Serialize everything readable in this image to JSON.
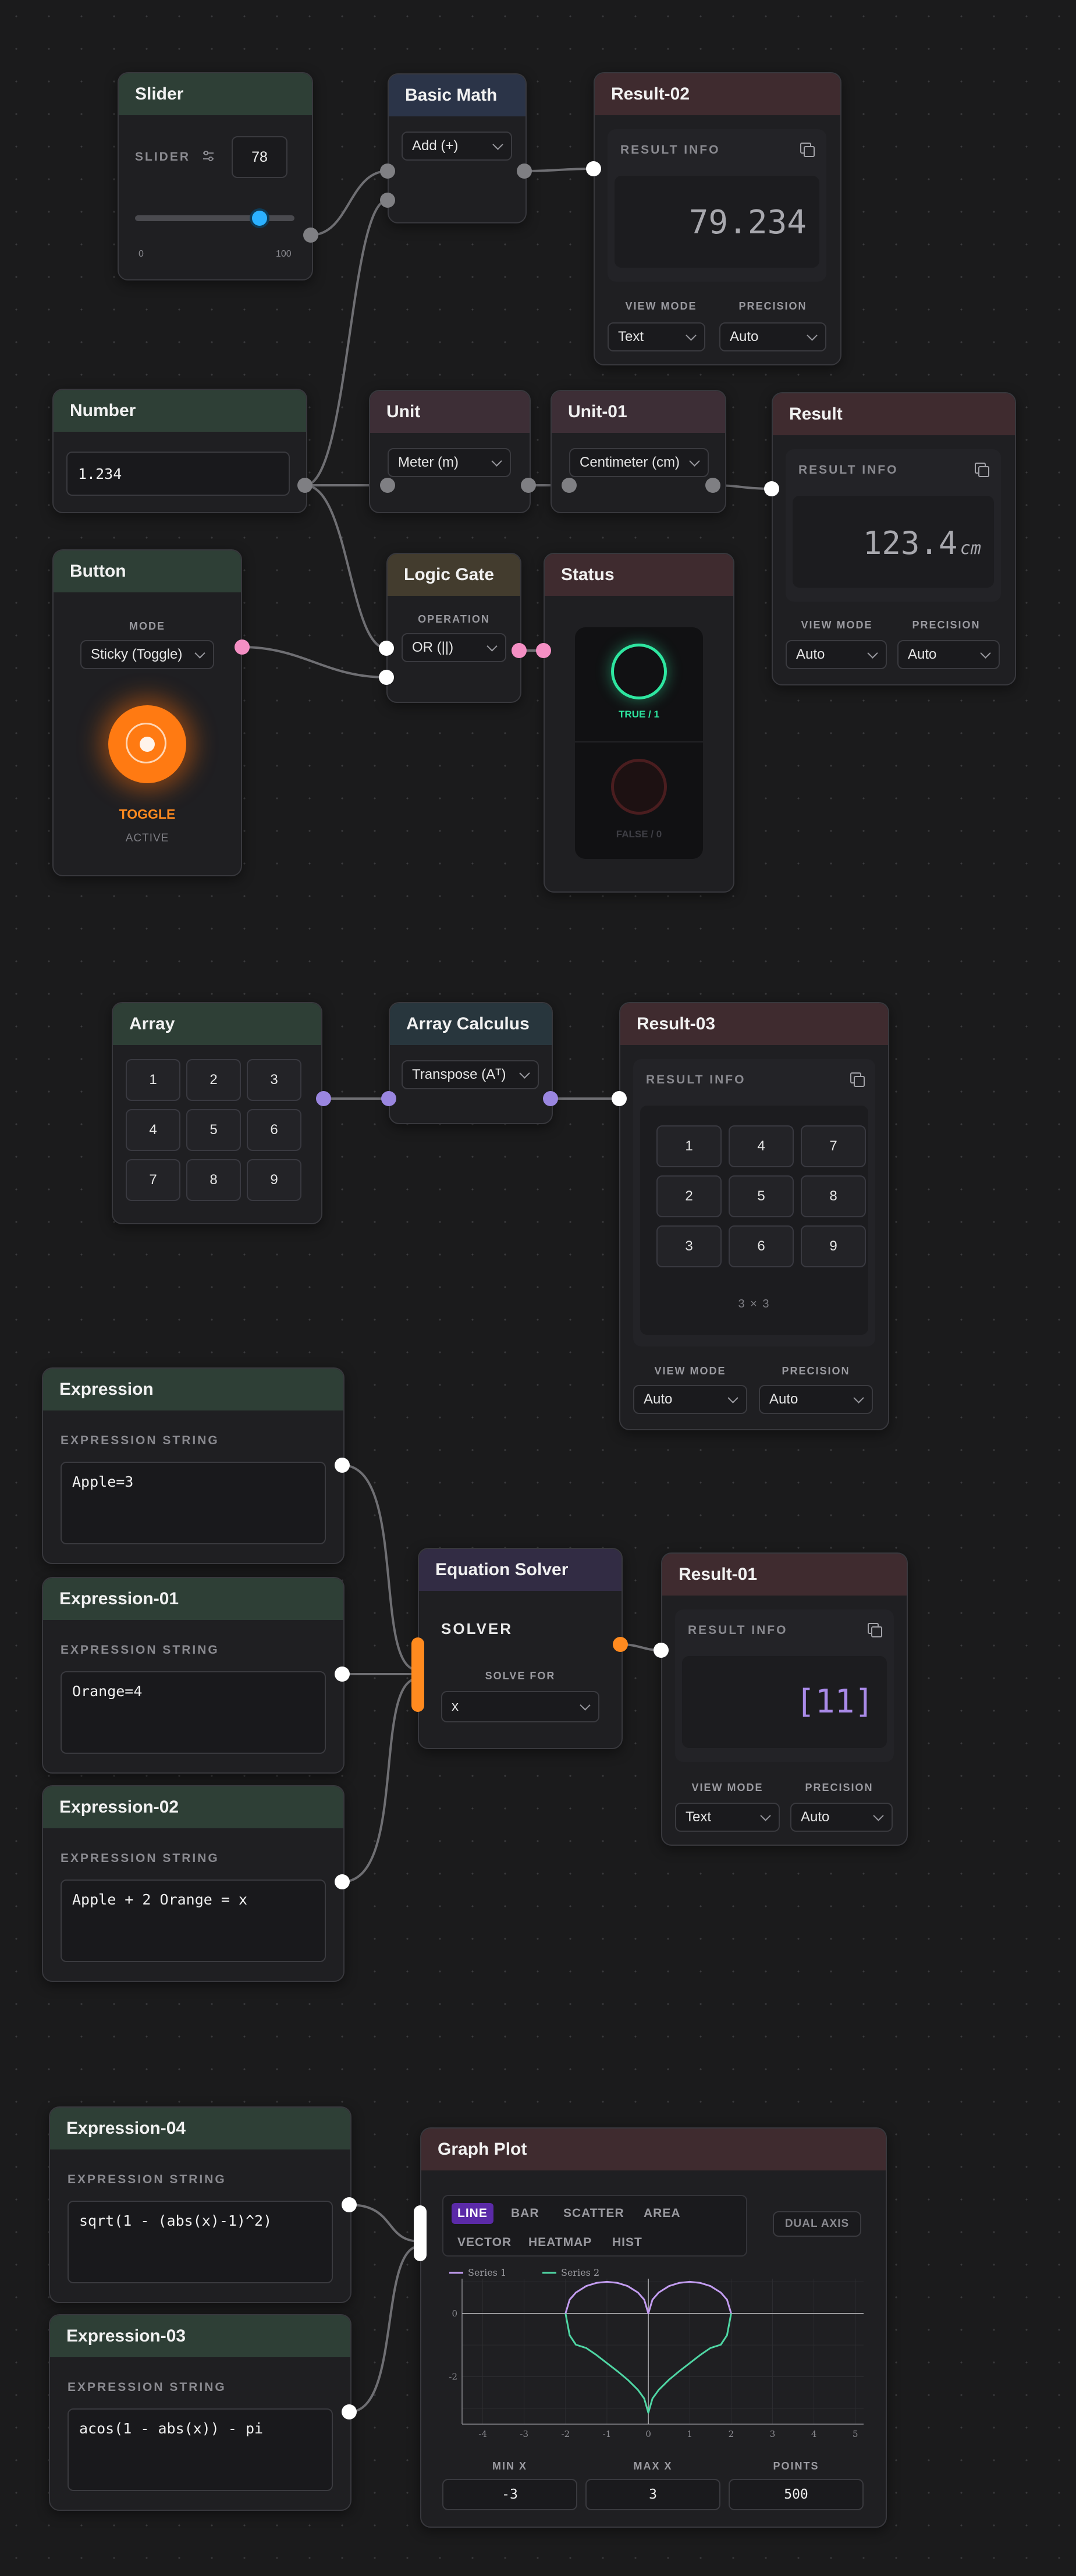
{
  "nodes": {
    "slider": {
      "title": "Slider",
      "label": "SLIDER",
      "value": "78",
      "min": "0",
      "max": "100",
      "fraction": 0.78
    },
    "basic_math": {
      "title": "Basic Math",
      "operation": "Add (+)"
    },
    "result_02": {
      "title": "Result-02",
      "info": "RESULT INFO",
      "value": "79.234",
      "view_mode_label": "VIEW MODE",
      "precision_label": "PRECISION",
      "view_mode": "Text",
      "precision": "Auto"
    },
    "number": {
      "title": "Number",
      "value": "1.234"
    },
    "unit": {
      "title": "Unit",
      "unit": "Meter (m)"
    },
    "unit_01": {
      "title": "Unit-01",
      "unit": "Centimeter (cm)"
    },
    "result": {
      "title": "Result",
      "info": "RESULT INFO",
      "value": "123.4",
      "unit": "cm",
      "view_mode_label": "VIEW MODE",
      "precision_label": "PRECISION",
      "view_mode": "Auto",
      "precision": "Auto"
    },
    "button": {
      "title": "Button",
      "mode_label": "MODE",
      "mode": "Sticky (Toggle)",
      "state_label": "TOGGLE",
      "status": "ACTIVE"
    },
    "logic_gate": {
      "title": "Logic Gate",
      "operation_label": "OPERATION",
      "operation": "OR (||)"
    },
    "status": {
      "title": "Status",
      "true_label": "TRUE / 1",
      "false_label": "FALSE / 0"
    },
    "array": {
      "title": "Array",
      "cells": [
        "1",
        "2",
        "3",
        "4",
        "5",
        "6",
        "7",
        "8",
        "9"
      ]
    },
    "array_calculus": {
      "title": "Array Calculus",
      "operation": "Transpose (Aᵀ)"
    },
    "result_03": {
      "title": "Result-03",
      "info": "RESULT INFO",
      "cells": [
        "1",
        "4",
        "7",
        "2",
        "5",
        "8",
        "3",
        "6",
        "9"
      ],
      "dims": "3 × 3",
      "view_mode_label": "VIEW MODE",
      "precision_label": "PRECISION",
      "view_mode": "Auto",
      "precision": "Auto"
    },
    "expression": {
      "title": "Expression",
      "label": "EXPRESSION STRING",
      "value": "Apple=3"
    },
    "expression_01": {
      "title": "Expression-01",
      "label": "EXPRESSION STRING",
      "value": "Orange=4"
    },
    "expression_02": {
      "title": "Expression-02",
      "label": "EXPRESSION STRING",
      "value": "Apple + 2 Orange = x"
    },
    "equation_solver": {
      "title": "Equation Solver",
      "solver_label": "SOLVER",
      "solve_for_label": "SOLVE FOR",
      "variable": "x"
    },
    "result_01": {
      "title": "Result-01",
      "info": "RESULT INFO",
      "value": "[11]",
      "view_mode_label": "VIEW MODE",
      "precision_label": "PRECISION",
      "view_mode": "Text",
      "precision": "Auto"
    },
    "expression_04": {
      "title": "Expression-04",
      "label": "EXPRESSION STRING",
      "value": "sqrt(1 - (abs(x)-1)^2)"
    },
    "expression_03": {
      "title": "Expression-03",
      "label": "EXPRESSION STRING",
      "value": "acos(1 - abs(x)) - pi"
    },
    "graph_plot": {
      "title": "Graph Plot",
      "tabs_row1": [
        "LINE",
        "BAR",
        "SCATTER",
        "AREA"
      ],
      "tabs_row2": [
        "VECTOR",
        "HEATMAP",
        "HIST"
      ],
      "active_tab": "LINE",
      "dual_axis": "DUAL AXIS",
      "min_x_label": "MIN X",
      "max_x_label": "MAX X",
      "points_label": "POINTS",
      "min_x": "-3",
      "max_x": "3",
      "points": "500"
    }
  },
  "colors": {
    "background": "#1b1b1c",
    "wire": "#6f6f73",
    "accent_orange": "#ff8a1f",
    "status_true": "#2ee6a0",
    "status_false": "#9e2a2a",
    "result_value_purple": "#a98ae8",
    "series1": "#c29cf0",
    "series2": "#4fd6a4"
  },
  "chart_data": {
    "type": "line",
    "title": "",
    "xlabel": "",
    "ylabel": "",
    "xlim": [
      -4.5,
      5.2
    ],
    "ylim": [
      -3.5,
      1.1
    ],
    "xticks": [
      -4,
      -3,
      -2,
      -1,
      0,
      1,
      2,
      3,
      4,
      5
    ],
    "yticks": [
      0,
      -2
    ],
    "grid": true,
    "legend_position": "top-left",
    "domain": [
      -2,
      2
    ],
    "series": [
      {
        "name": "Series 1",
        "color": "#c29cf0",
        "x": [
          -2,
          -1.9,
          -1.75,
          -1.5,
          -1.25,
          -1,
          -0.75,
          -0.5,
          -0.25,
          -0.1,
          0,
          0.1,
          0.25,
          0.5,
          0.75,
          1,
          1.25,
          1.5,
          1.75,
          1.9,
          2
        ],
        "y": [
          0,
          0.436,
          0.661,
          0.866,
          0.968,
          1,
          0.968,
          0.866,
          0.661,
          0.436,
          0,
          0.436,
          0.661,
          0.866,
          0.968,
          1,
          0.968,
          0.866,
          0.661,
          0.436,
          0
        ]
      },
      {
        "name": "Series 2",
        "color": "#4fd6a4",
        "x": [
          -2,
          -1.9,
          -1.75,
          -1.5,
          -1.25,
          -1,
          -0.75,
          -0.5,
          -0.25,
          -0.1,
          0,
          0.1,
          0.25,
          0.5,
          0.75,
          1,
          1.25,
          1.5,
          1.75,
          1.9,
          2
        ],
        "y": [
          0,
          -0.691,
          -0.988,
          -1.094,
          -1.318,
          -1.571,
          -1.823,
          -2.094,
          -2.418,
          -2.69,
          -3.142,
          -2.69,
          -2.418,
          -2.094,
          -1.823,
          -1.571,
          -1.318,
          -1.094,
          -0.988,
          -0.691,
          0
        ]
      }
    ]
  }
}
